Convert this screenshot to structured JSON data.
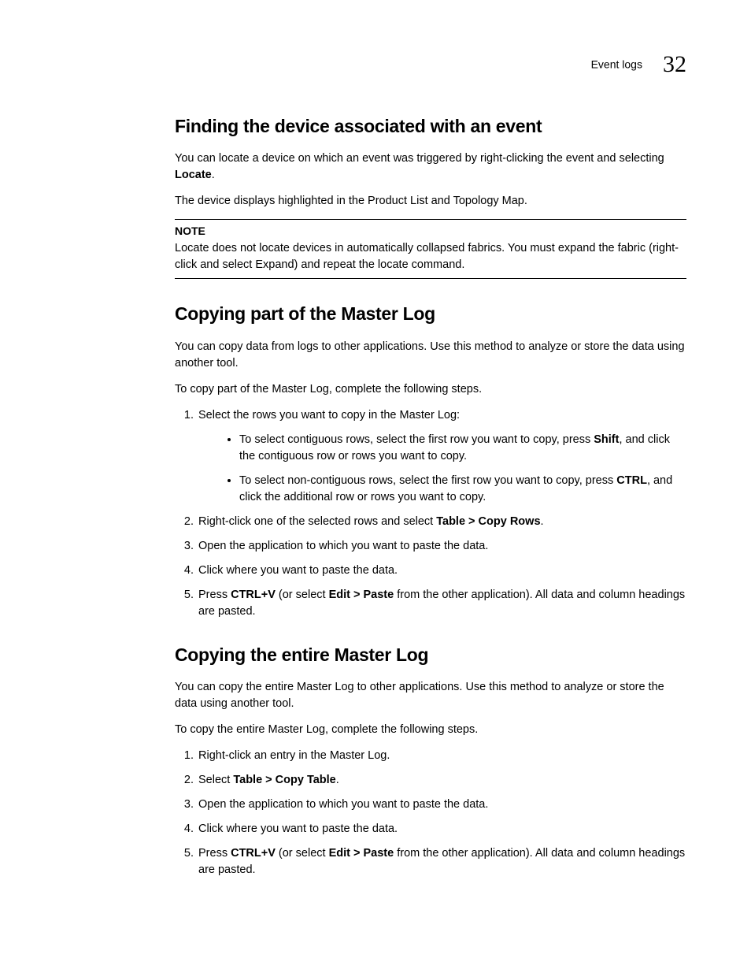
{
  "header": {
    "section": "Event logs",
    "chapter_number": "32"
  },
  "s1": {
    "title": "Finding the device associated with an event",
    "p1a": "You can locate a device on which an event was triggered by right-clicking the event and selecting ",
    "p1b": "Locate",
    "p1c": ".",
    "p2": "The device displays highlighted in the Product List and Topology Map.",
    "note_label": "NOTE",
    "note_body": "Locate does not locate devices in automatically collapsed fabrics. You must expand the fabric (right-click and select Expand) and repeat the locate command."
  },
  "s2": {
    "title": "Copying part of the Master Log",
    "p1": "You can copy data from logs to other applications. Use this method to analyze or store the data using another tool.",
    "p2": "To copy part of the Master Log, complete the following steps.",
    "step1": "Select the rows you want to copy in the Master Log:",
    "b1a": "To select contiguous rows, select the first row you want to copy, press ",
    "b1b": "Shift",
    "b1c": ", and click the contiguous row or rows you want to copy.",
    "b2a": "To select non-contiguous rows, select the first row you want to copy, press ",
    "b2b": "CTRL",
    "b2c": ", and click the additional row or rows you want to copy.",
    "step2a": "Right-click one of the selected rows and select ",
    "step2b": "Table > Copy Rows",
    "step2c": ".",
    "step3": "Open the application to which you want to paste the data.",
    "step4": "Click where you want to paste the data.",
    "step5a": "Press ",
    "step5b": "CTRL+V",
    "step5c": " (or select ",
    "step5d": "Edit > Paste",
    "step5e": " from the other application). All data and column headings are pasted."
  },
  "s3": {
    "title": "Copying the entire Master Log",
    "p1": "You can copy the entire Master Log to other applications. Use this method to analyze or store the data using another tool.",
    "p2": "To copy the entire Master Log, complete the following steps.",
    "step1": "Right-click an entry in the Master Log.",
    "step2a": "Select ",
    "step2b": "Table > Copy Table",
    "step2c": ".",
    "step3": "Open the application to which you want to paste the data.",
    "step4": "Click where you want to paste the data.",
    "step5a": "Press ",
    "step5b": "CTRL+V",
    "step5c": " (or select ",
    "step5d": "Edit > Paste",
    "step5e": " from the other application). All data and column headings are pasted."
  }
}
